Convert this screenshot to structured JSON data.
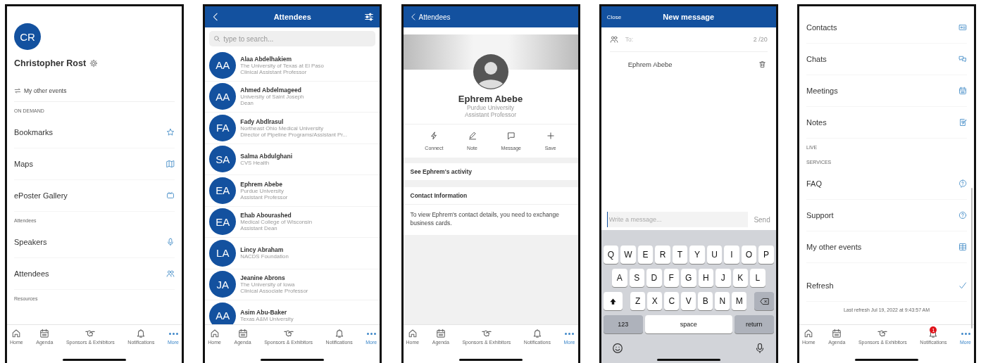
{
  "screens": [
    {
      "kind": "profile_menu",
      "avatar_initials": "CR",
      "user_name": "Christopher Rost",
      "other_events_link": "My other events",
      "menu": [
        {
          "kind": "header",
          "label": "ON DEMAND"
        },
        {
          "kind": "item",
          "label": "Bookmarks"
        },
        {
          "kind": "item",
          "label": "Maps"
        },
        {
          "kind": "item",
          "label": "ePoster Gallery"
        },
        {
          "kind": "header",
          "label": "Attendees"
        },
        {
          "kind": "item",
          "label": "Speakers"
        },
        {
          "kind": "item",
          "label": "Attendees"
        },
        {
          "kind": "header",
          "label": "Resources"
        }
      ],
      "tab_bar": [
        {
          "label": "Home",
          "selected": false
        },
        {
          "label": "Agenda",
          "selected": false
        },
        {
          "label": "Sponsors & Exhibitors",
          "selected": false
        },
        {
          "label": "Notifications",
          "selected": false
        },
        {
          "label": "More",
          "selected": true
        }
      ]
    },
    {
      "kind": "attendee_list",
      "title": "Attendees",
      "search": {
        "placeholder": "type to search..."
      },
      "attendees": [
        {
          "initials": "AA",
          "name": "Alaa Abdelhakiem",
          "organization": "The University of Texas at El Paso",
          "position": "Clinical Assistant Professor"
        },
        {
          "initials": "AA",
          "name": "Ahmed Abdelmageed",
          "organization": "University of Saint Joseph",
          "position": "Dean"
        },
        {
          "initials": "FA",
          "name": "Fady Abdlrasul",
          "organization": "Northeast Ohio Medical University",
          "position": "Director of Pipeline Programs/Assistant Pr..."
        },
        {
          "initials": "SA",
          "name": "Salma Abdulghani",
          "organization": "CVS Health"
        },
        {
          "initials": "EA",
          "name": "Ephrem Abebe",
          "organization": "Purdue University",
          "position": "Assistant Professor"
        },
        {
          "initials": "EA",
          "name": "Ehab Abourashed",
          "organization": "Medical College of Wisconsin",
          "position": "Assistant Dean"
        },
        {
          "initials": "LA",
          "name": "Lincy Abraham",
          "organization": "NACDS Foundation"
        },
        {
          "initials": "JA",
          "name": "Jeanine Abrons",
          "organization": "The University of Iowa",
          "position": "Clinical Associate Professor"
        },
        {
          "initials": "AA",
          "name": "Asim Abu-Baker",
          "organization": "Texas A&M University"
        }
      ],
      "tab_bar": [
        {
          "label": "Home",
          "selected": false
        },
        {
          "label": "Agenda",
          "selected": false
        },
        {
          "label": "Sponsors & Exhibitors",
          "selected": false
        },
        {
          "label": "Notifications",
          "selected": false
        },
        {
          "label": "More",
          "selected": true
        }
      ]
    },
    {
      "kind": "attendee_profile",
      "back_label": "Attendees",
      "name": "Ephrem Abebe",
      "organization": "Purdue University",
      "position": "Assistant Professor",
      "actions": [
        "Connect",
        "Note",
        "Message",
        "Save"
      ],
      "activity_link": "See Ephrem's activity",
      "contact_heading": "Contact Information",
      "contact_text": "To view Ephrem's contact details, you need to exchange business cards.",
      "tab_bar": [
        {
          "label": "Home",
          "selected": false
        },
        {
          "label": "Agenda",
          "selected": false
        },
        {
          "label": "Sponsors & Exhibitors",
          "selected": false
        },
        {
          "label": "Notifications",
          "selected": false
        },
        {
          "label": "More",
          "selected": true
        }
      ]
    },
    {
      "kind": "new_message",
      "close_label": "Close",
      "title": "New message",
      "to": {
        "placeholder": "To:"
      },
      "recipient_count": "2 /20",
      "recipients": [
        "Ephrem Abebe"
      ],
      "compose": {
        "placeholder": "Write a message..."
      },
      "send_label": "Send",
      "keyboard": {
        "rows": [
          [
            "Q",
            "W",
            "E",
            "R",
            "T",
            "Y",
            "U",
            "I",
            "O",
            "P"
          ],
          [
            "A",
            "S",
            "D",
            "F",
            "G",
            "H",
            "J",
            "K",
            "L"
          ],
          [
            "Z",
            "X",
            "C",
            "V",
            "B",
            "N",
            "M"
          ]
        ],
        "number_key": "123",
        "space_key": "space",
        "return_key": "return"
      }
    },
    {
      "kind": "more_menu",
      "menu": [
        {
          "kind": "item",
          "label": "Contacts"
        },
        {
          "kind": "item",
          "label": "Chats"
        },
        {
          "kind": "item",
          "label": "Meetings"
        },
        {
          "kind": "item",
          "label": "Notes"
        },
        {
          "kind": "header",
          "label": "LIVE"
        },
        {
          "kind": "header",
          "label": "SERVICES"
        },
        {
          "kind": "item",
          "label": "FAQ"
        },
        {
          "kind": "item",
          "label": "Support"
        },
        {
          "kind": "item",
          "label": "My other events"
        },
        {
          "kind": "action",
          "label": "Refresh"
        }
      ],
      "last_refresh": "Last refresh Jul 19, 2022 at 9:43:57 AM",
      "tab_bar": [
        {
          "label": "Home",
          "selected": false
        },
        {
          "label": "Agenda",
          "selected": false
        },
        {
          "label": "Sponsors & Exhibitors",
          "selected": false
        },
        {
          "label": "Notifications",
          "selected": false,
          "badge": "1"
        },
        {
          "label": "More",
          "selected": true
        }
      ]
    }
  ]
}
